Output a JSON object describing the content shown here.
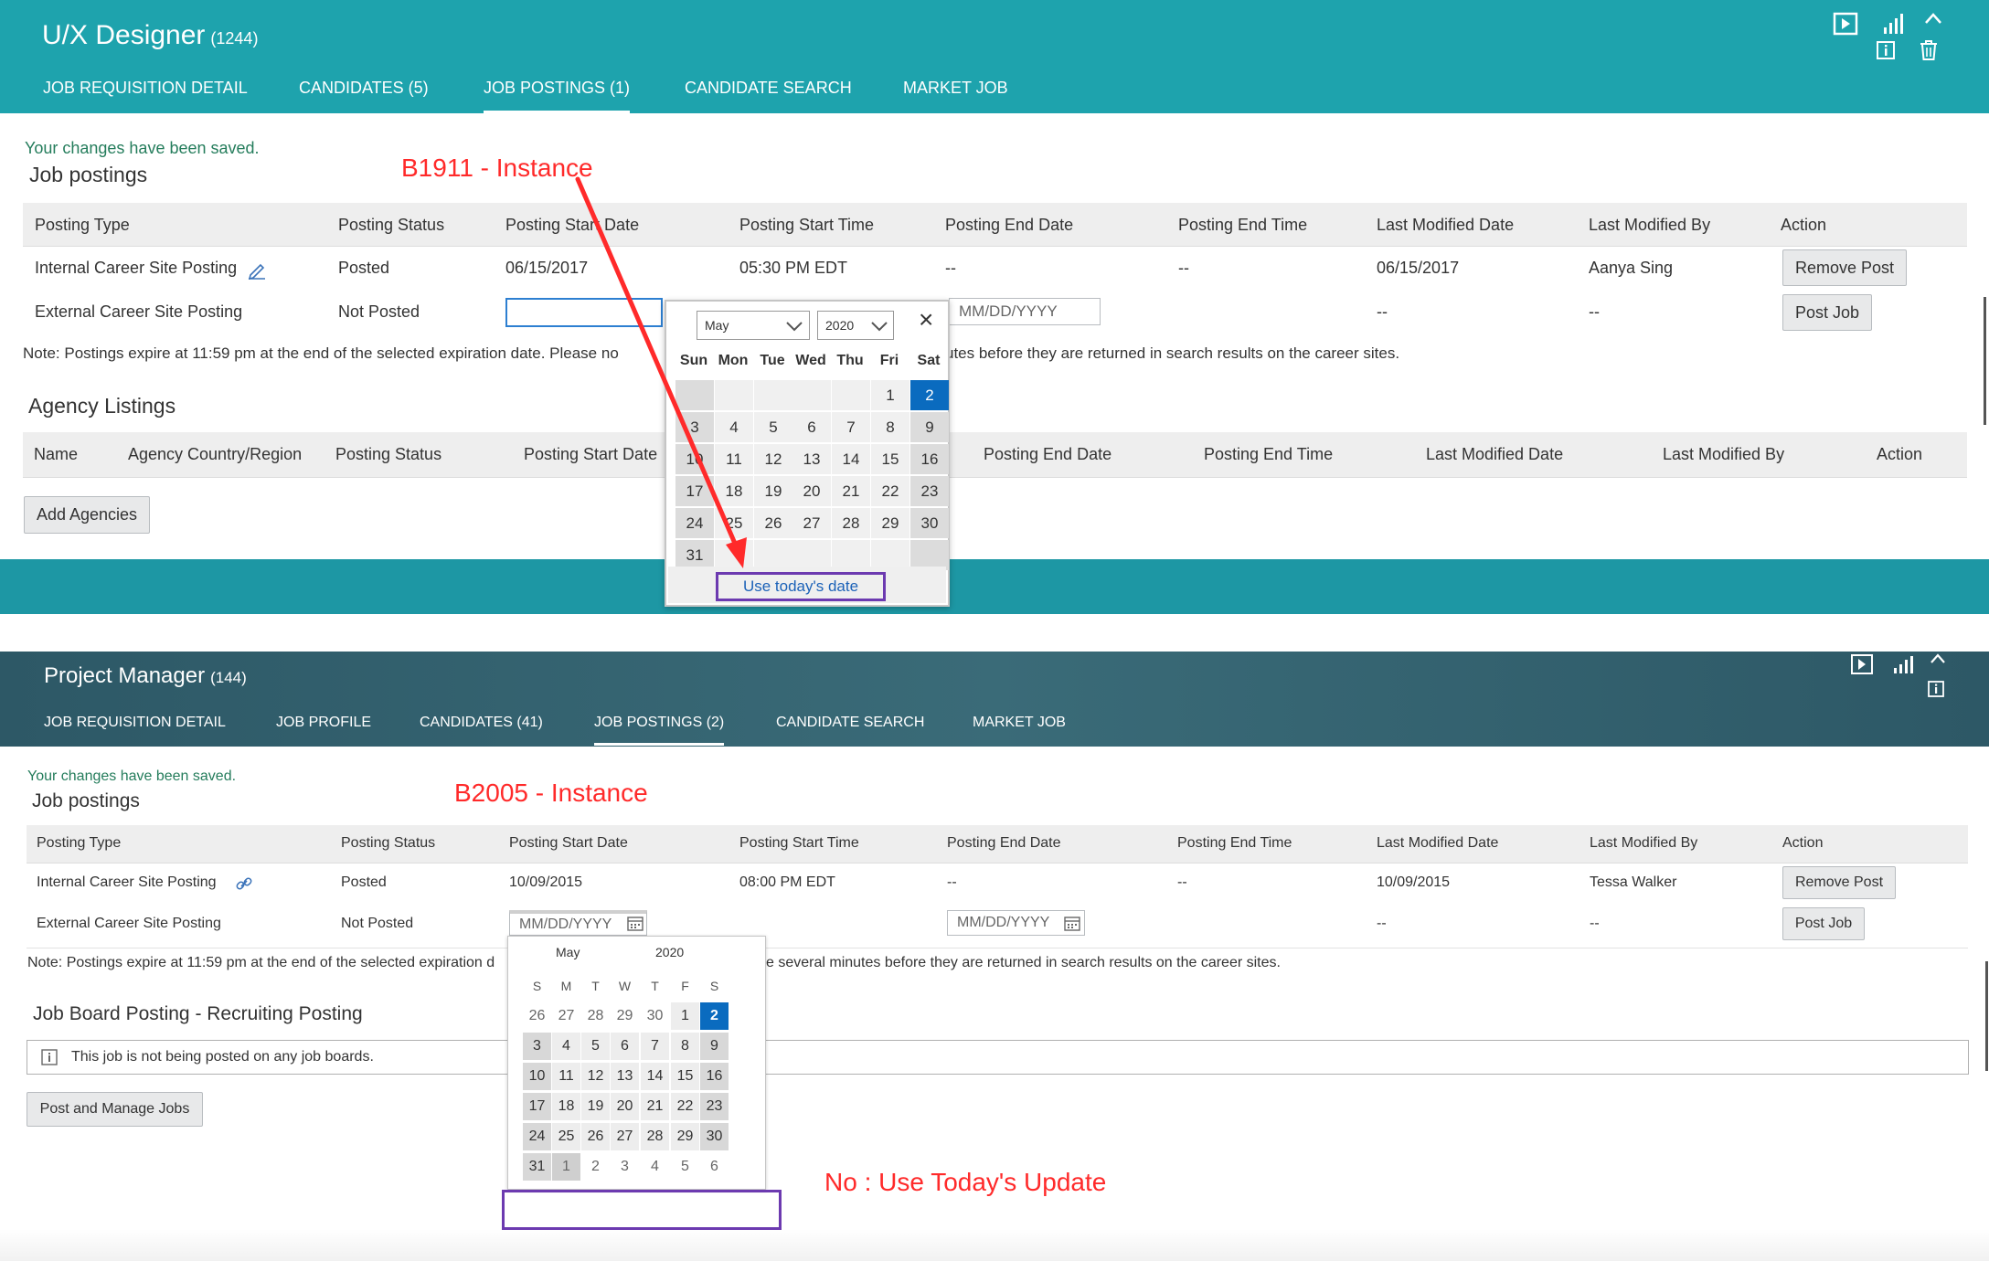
{
  "req1": {
    "title": "U/X Designer",
    "count": "(1244)",
    "tabs": [
      "JOB REQUISITION DETAIL",
      "CANDIDATES (5)",
      "JOB POSTINGS (1)",
      "CANDIDATE SEARCH",
      "MARKET JOB"
    ],
    "saved_msg": "Your changes have been saved.",
    "job_postings_heading": "Job postings",
    "annotation": "B1911 - Instance",
    "table_headers": [
      "Posting Type",
      "Posting Status",
      "Posting Start Date",
      "Posting Start Time",
      "Posting End Date",
      "Posting End Time",
      "Last Modified Date",
      "Last Modified By",
      "Action"
    ],
    "rows": [
      {
        "type": "Internal Career Site Posting",
        "status": "Posted",
        "start_date": "06/15/2017",
        "start_time": "05:30 PM EDT",
        "end_date": "--",
        "end_time": "--",
        "mod_date": "06/15/2017",
        "mod_by": "Aanya Sing",
        "action": "Remove Post"
      },
      {
        "type": "External Career Site Posting",
        "status": "Not Posted",
        "end_date_placeholder": "MM/DD/YYYY",
        "mod_date": "--",
        "mod_by": "--",
        "action": "Post Job"
      }
    ],
    "note_left": "Note: Postings expire at 11:59 pm at the end of the selected expiration date. Please no",
    "note_right": "utes before they are returned in search results on the career sites.",
    "agency_heading": "Agency Listings",
    "agency_headers": [
      "Name",
      "Agency Country/Region",
      "Posting Status",
      "Posting Start Date",
      "Posting End Date",
      "Posting End Time",
      "Last Modified Date",
      "Last Modified By",
      "Action"
    ],
    "add_agencies": "Add Agencies",
    "calendar": {
      "month": "May",
      "year": "2020",
      "close": "×",
      "dow": [
        "Sun",
        "Mon",
        "Tue",
        "Wed",
        "Thu",
        "Fri",
        "Sat"
      ],
      "weeks": [
        [
          "",
          "",
          "",
          "",
          "",
          "1",
          "2"
        ],
        [
          "3",
          "4",
          "5",
          "6",
          "7",
          "8",
          "9"
        ],
        [
          "10",
          "11",
          "12",
          "13",
          "14",
          "15",
          "16"
        ],
        [
          "17",
          "18",
          "19",
          "20",
          "21",
          "22",
          "23"
        ],
        [
          "24",
          "25",
          "26",
          "27",
          "28",
          "29",
          "30"
        ],
        [
          "31",
          "",
          "",
          "",
          "",
          "",
          ""
        ]
      ],
      "today_link": "Use today's date"
    },
    "icons": [
      "play-icon",
      "bar-chart-icon",
      "chevron-up-icon",
      "info-icon",
      "trash-icon"
    ]
  },
  "req2": {
    "title": "Project Manager",
    "count": "(144)",
    "tabs": [
      "JOB REQUISITION DETAIL",
      "JOB PROFILE",
      "CANDIDATES (41)",
      "JOB POSTINGS (2)",
      "CANDIDATE SEARCH",
      "MARKET JOB"
    ],
    "saved_msg": "Your changes have been saved.",
    "job_postings_heading": "Job postings",
    "annotation": "B2005 - Instance",
    "table_headers": [
      "Posting Type",
      "Posting Status",
      "Posting Start Date",
      "Posting Start Time",
      "Posting End Date",
      "Posting End Time",
      "Last Modified Date",
      "Last Modified By",
      "Action"
    ],
    "rows": [
      {
        "type": "Internal Career Site Posting",
        "status": "Posted",
        "start_date": "10/09/2015",
        "start_time": "08:00 PM EDT",
        "end_date": "--",
        "end_time": "--",
        "mod_date": "10/09/2015",
        "mod_by": "Tessa Walker",
        "action": "Remove Post"
      },
      {
        "type": "External Career Site Posting",
        "status": "Not Posted",
        "start_date_placeholder": "MM/DD/YYYY",
        "end_date_placeholder": "MM/DD/YYYY",
        "mod_date": "--",
        "mod_by": "--",
        "action": "Post Job"
      }
    ],
    "note_left": "Note: Postings expire at 11:59 pm at the end of the selected expiration d",
    "note_right": "e several minutes before they are returned in search results on the career sites.",
    "job_board_heading": "Job Board Posting - Recruiting Posting",
    "job_board_info": "This job is not being posted on any job boards.",
    "post_manage": "Post and Manage Jobs",
    "annotation_bottom": "No : Use Today's Update",
    "calendar": {
      "month": "May",
      "year": "2020",
      "dow": [
        "S",
        "M",
        "T",
        "W",
        "T",
        "F",
        "S"
      ],
      "weeks": [
        [
          "26",
          "27",
          "28",
          "29",
          "30",
          "1",
          "2"
        ],
        [
          "3",
          "4",
          "5",
          "6",
          "7",
          "8",
          "9"
        ],
        [
          "10",
          "11",
          "12",
          "13",
          "14",
          "15",
          "16"
        ],
        [
          "17",
          "18",
          "19",
          "20",
          "21",
          "22",
          "23"
        ],
        [
          "24",
          "25",
          "26",
          "27",
          "28",
          "29",
          "30"
        ],
        [
          "31",
          "1",
          "2",
          "3",
          "4",
          "5",
          "6"
        ]
      ]
    },
    "icons": [
      "play-icon",
      "bar-chart-icon",
      "chevron-up-icon",
      "info-icon"
    ]
  }
}
